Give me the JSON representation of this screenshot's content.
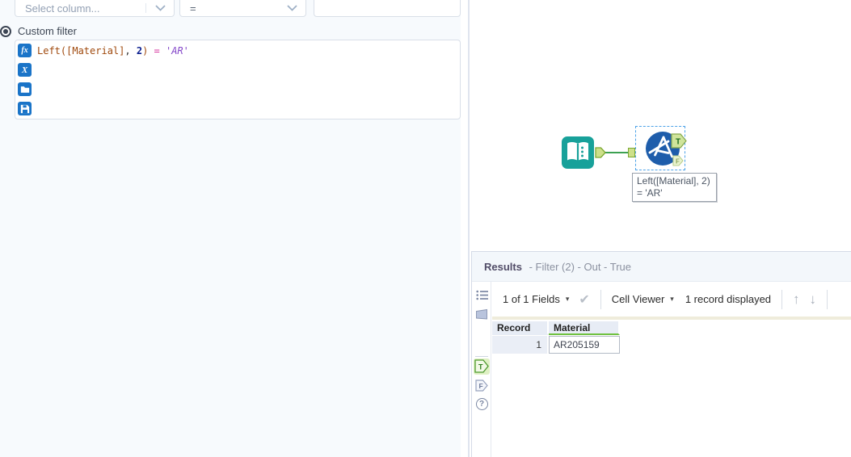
{
  "colors": {
    "accent_blue": "#1a74c8",
    "tool_teal": "#18a19a",
    "filter_blue": "#1e5dab",
    "connection_green": "#3da152",
    "anchor_green_fill": "#cde08a",
    "selected_column_underline": "#6fc13e",
    "results_title_color": "#524d68"
  },
  "filter_panel": {
    "select_column": {
      "placeholder": "Select column..."
    },
    "operator_dropdown": {
      "value": "="
    },
    "value_input": {
      "value": "",
      "placeholder": ""
    },
    "custom_filter_label": "Custom filter",
    "editor": {
      "fx_glyph": "fx",
      "x_glyph": "X",
      "formula_tokens": {
        "fn": "Left(",
        "field": "[Material]",
        "comma": ", ",
        "num": "2",
        "close": ")",
        "op": " = ",
        "str": "'AR'"
      }
    }
  },
  "canvas": {
    "filter_anchor_true": "T",
    "filter_anchor_false": "F",
    "annotation": {
      "line1": "Left([Material], 2)",
      "line2": "= 'AR'"
    }
  },
  "results": {
    "title": "Results",
    "subtitle": "- Filter (2) - Out - True",
    "toolbar": {
      "fields_label": "1 of 1 Fields",
      "caret_glyph": "▾",
      "check_glyph": "✔",
      "cell_viewer_label": "Cell Viewer",
      "records_label": "1 record displayed",
      "up_glyph": "↑",
      "down_glyph": "↓"
    },
    "side_tabs": {
      "true_label": "T",
      "false_label": "F",
      "help_glyph": "?"
    },
    "table": {
      "columns": [
        "Record",
        "Material"
      ],
      "rows": [
        [
          "1",
          "AR205159"
        ]
      ]
    }
  }
}
